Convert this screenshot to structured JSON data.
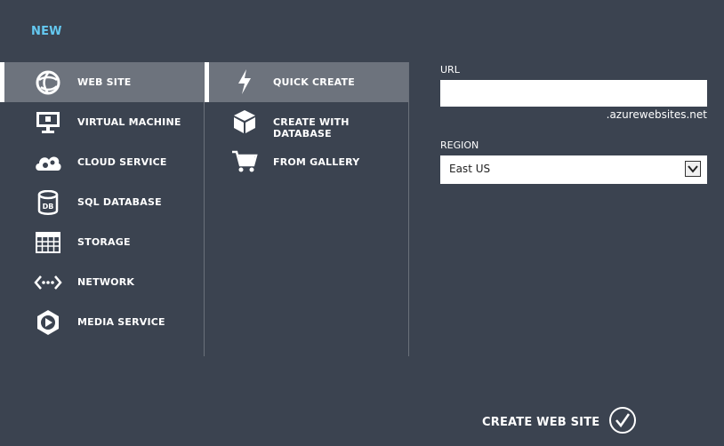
{
  "header": {
    "title": "NEW"
  },
  "categories": [
    {
      "label": "WEB SITE",
      "icon": "globe-icon",
      "selected": true
    },
    {
      "label": "VIRTUAL MACHINE",
      "icon": "monitor-icon"
    },
    {
      "label": "CLOUD SERVICE",
      "icon": "cloud-gear-icon"
    },
    {
      "label": "SQL DATABASE",
      "icon": "database-icon"
    },
    {
      "label": "STORAGE",
      "icon": "grid-storage-icon"
    },
    {
      "label": "NETWORK",
      "icon": "network-icon"
    },
    {
      "label": "MEDIA SERVICE",
      "icon": "media-play-icon"
    }
  ],
  "options": [
    {
      "label": "QUICK CREATE",
      "icon": "lightning-icon",
      "selected": true
    },
    {
      "label": "CREATE WITH DATABASE",
      "icon": "box-icon"
    },
    {
      "label": "FROM GALLERY",
      "icon": "cart-icon"
    }
  ],
  "form": {
    "url_label": "URL",
    "url_value": "",
    "url_suffix": ".azurewebsites.net",
    "region_label": "REGION",
    "region_value": "East US"
  },
  "footer": {
    "create_label": "CREATE WEB SITE",
    "icon": "check-circle-icon"
  },
  "colors": {
    "background": "#3b4350",
    "accent": "#64c8f0",
    "selected": "#6d737d"
  }
}
